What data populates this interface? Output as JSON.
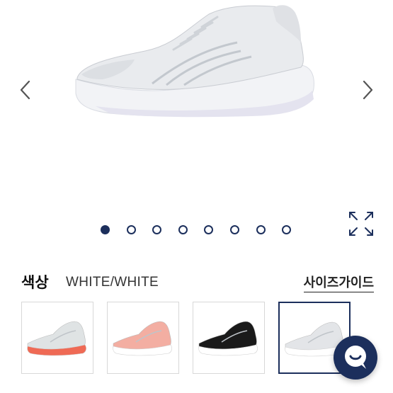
{
  "gallery": {
    "image_name": "white-running-shoe-image",
    "dot_count": 8,
    "active_index": 0,
    "accent_color": "#1c2f5c"
  },
  "color": {
    "title": "색상",
    "value": "WHITE/WHITE"
  },
  "size_guide": {
    "label": "사이즈가이드"
  },
  "swatches": [
    {
      "name": "light-grey-coral-sole",
      "upper": "#dfe3e4",
      "sole": "#ef6a55",
      "selected": false
    },
    {
      "name": "pink-white-sole",
      "upper": "#f3aea2",
      "sole": "#ffffff",
      "selected": false
    },
    {
      "name": "black-white-sole",
      "upper": "#1a1a1a",
      "sole": "#ffffff",
      "selected": false
    },
    {
      "name": "white-white",
      "upper": "#e3e5e8",
      "sole": "#ffffff",
      "selected": true
    }
  ],
  "chat": {
    "icon": "chat-bubble-icon"
  }
}
